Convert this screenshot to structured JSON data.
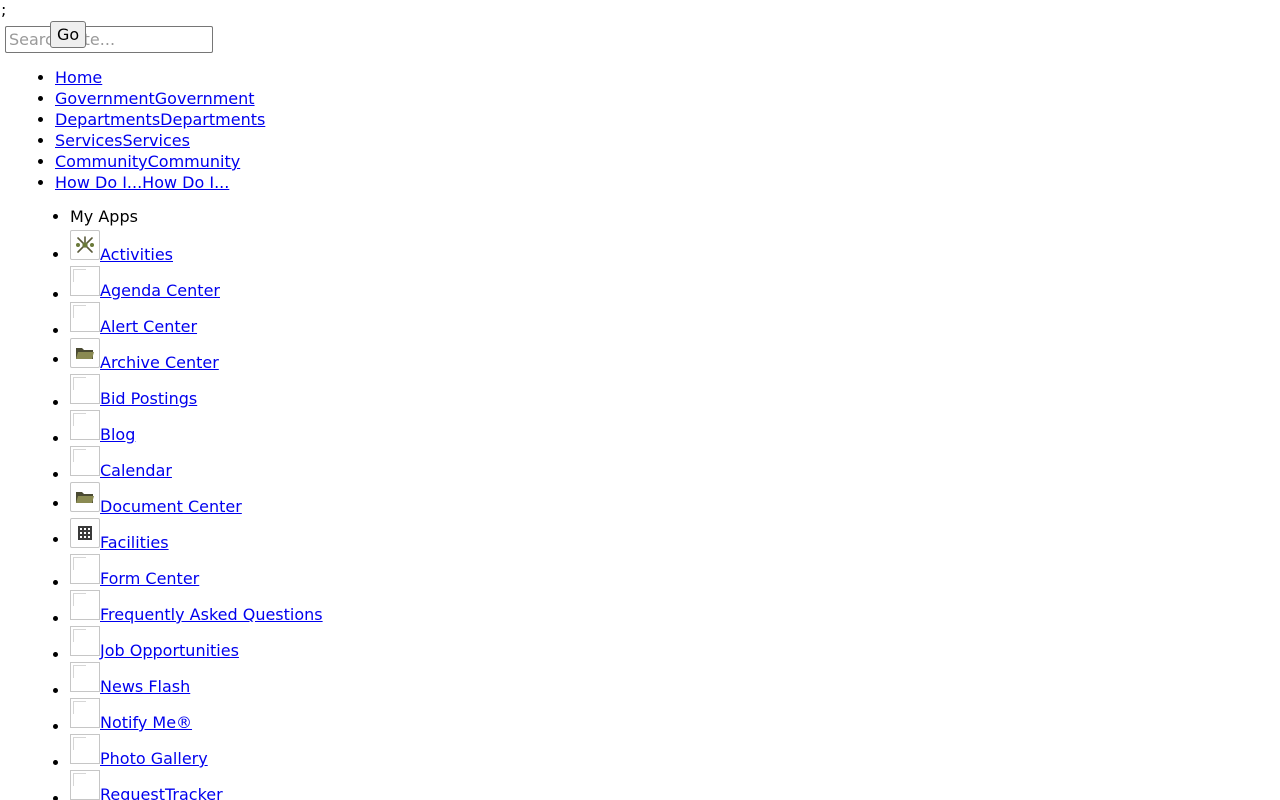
{
  "stray_text": ";",
  "search": {
    "placeholder": "Search Site...",
    "go_label": "Go"
  },
  "main_nav": [
    {
      "label": "Home"
    },
    {
      "label": "GovernmentGovernment"
    },
    {
      "label": "DepartmentsDepartments"
    },
    {
      "label": "ServicesServices"
    },
    {
      "label": "CommunityCommunity"
    },
    {
      "label": "How Do I...How Do I..."
    }
  ],
  "apps": {
    "header": "My Apps",
    "items": [
      {
        "label": "Activities",
        "icon": "activities-icon"
      },
      {
        "label": "Agenda Center",
        "icon": "broken-image-icon"
      },
      {
        "label": "Alert Center",
        "icon": "broken-image-icon"
      },
      {
        "label": "Archive Center",
        "icon": "folder-icon"
      },
      {
        "label": "Bid Postings",
        "icon": "broken-image-icon"
      },
      {
        "label": "Blog",
        "icon": "broken-image-icon"
      },
      {
        "label": "Calendar",
        "icon": "broken-image-icon"
      },
      {
        "label": "Document Center",
        "icon": "folder-icon"
      },
      {
        "label": "Facilities",
        "icon": "building-icon"
      },
      {
        "label": "Form Center",
        "icon": "broken-image-icon"
      },
      {
        "label": "Frequently Asked Questions",
        "icon": "broken-image-icon"
      },
      {
        "label": "Job Opportunities",
        "icon": "broken-image-icon"
      },
      {
        "label": "News Flash",
        "icon": "broken-image-icon"
      },
      {
        "label": "Notify Me®",
        "icon": "broken-image-icon"
      },
      {
        "label": "Photo Gallery",
        "icon": "broken-image-icon"
      },
      {
        "label": "RequestTracker",
        "icon": "broken-image-icon"
      }
    ]
  }
}
